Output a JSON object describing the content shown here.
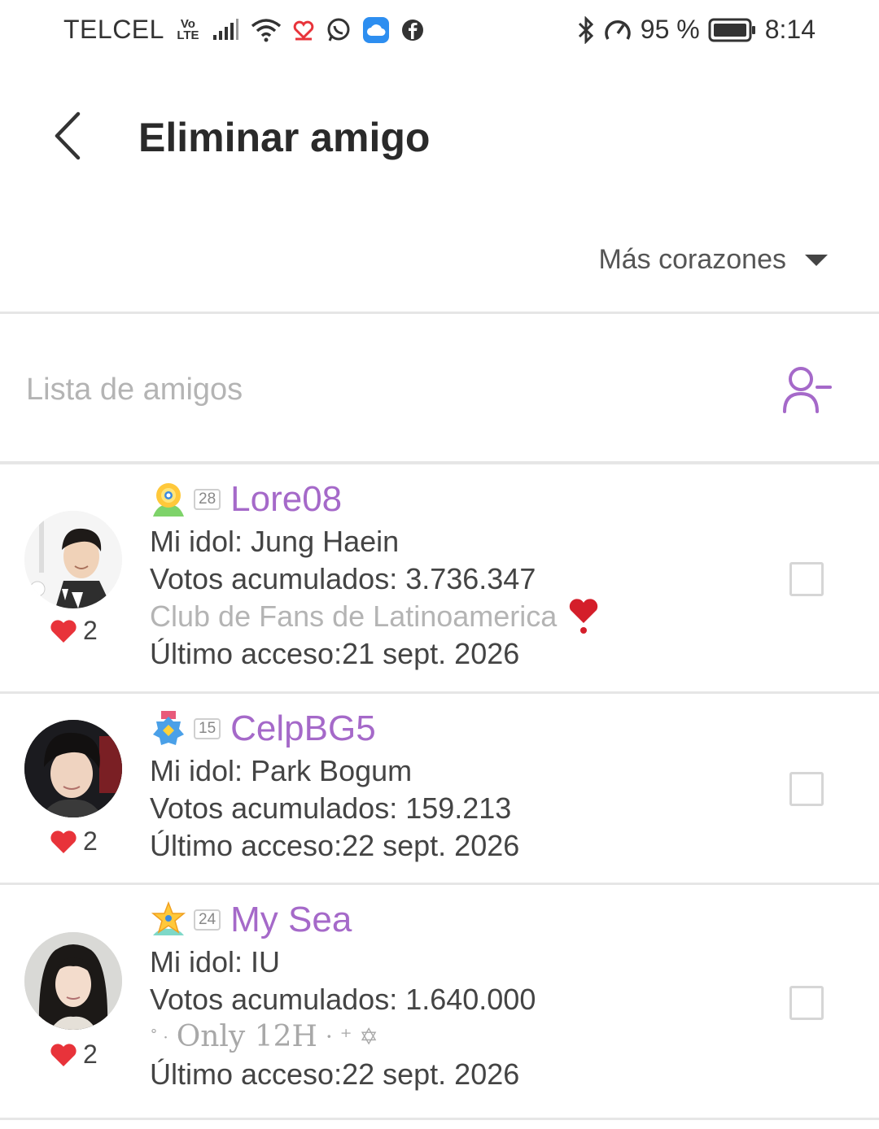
{
  "status_bar": {
    "carrier": "TELCEL",
    "volte_top": "Vo",
    "volte_bottom": "LTE",
    "battery_pct": "95 %",
    "time": "8:14",
    "icons": [
      "signal-icon",
      "wifi-icon",
      "heart-app-icon",
      "whatsapp-icon",
      "cloud-icon",
      "facebook-icon",
      "bluetooth-icon",
      "speed-icon",
      "battery-icon"
    ]
  },
  "header": {
    "back_icon": "chevron-left-icon",
    "title": "Eliminar amigo"
  },
  "sort": {
    "label": "Más corazones",
    "icon": "caret-down-icon"
  },
  "list": {
    "title": "Lista de amigos",
    "remove_icon": "remove-user-icon"
  },
  "friends": [
    {
      "level": "28",
      "name": "Lore08",
      "idol": "Mi idol: Jung Haein",
      "votes": "Votos acumulados: 3.736.347",
      "club": "Club de Fans de Latinoamerica",
      "last_access": "Último acceso:21 sept. 2026",
      "hearts": "2"
    },
    {
      "level": "15",
      "name": "CelpBG5",
      "idol": "Mi idol: Park Bogum",
      "votes": "Votos acumulados: 159.213",
      "last_access": "Último acceso:22 sept. 2026",
      "hearts": "2"
    },
    {
      "level": "24",
      "name": "My Sea",
      "idol": "Mi idol: IU",
      "votes": "Votos acumulados: 1.640.000",
      "club": "Only 12H",
      "last_access": "Último acceso:22 sept. 2026",
      "hearts": "2"
    }
  ],
  "colors": {
    "accent": "#a569c9",
    "heart": "#e8333a",
    "divider": "#e6e6e6"
  }
}
